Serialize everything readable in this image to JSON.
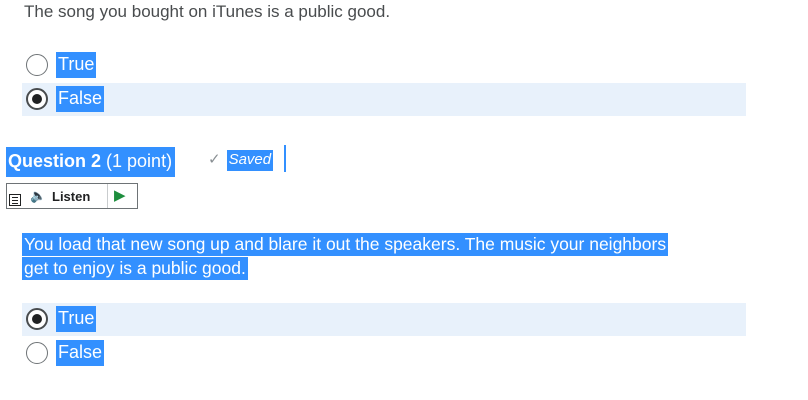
{
  "question1": {
    "text": "The song you bought on iTunes is a public good.",
    "options": [
      {
        "label": "True",
        "checked": false
      },
      {
        "label": "False",
        "checked": true
      }
    ]
  },
  "question2": {
    "title": "Question 2",
    "points": "(1 point)",
    "status": "Saved",
    "listen_label": "Listen",
    "text_line1": "You load that new song up and blare it out the speakers. The music your neighbors",
    "text_line2": "get to enjoy is a public good.",
    "options": [
      {
        "label": "True",
        "checked": true
      },
      {
        "label": "False",
        "checked": false
      }
    ]
  },
  "colors": {
    "selection": "#3390ff",
    "selected_option_bg": "#e8f1fb",
    "play_icon": "#1e8e3e"
  },
  "icons": [
    "check-icon",
    "menu-icon",
    "speaker-icon",
    "play-icon"
  ]
}
